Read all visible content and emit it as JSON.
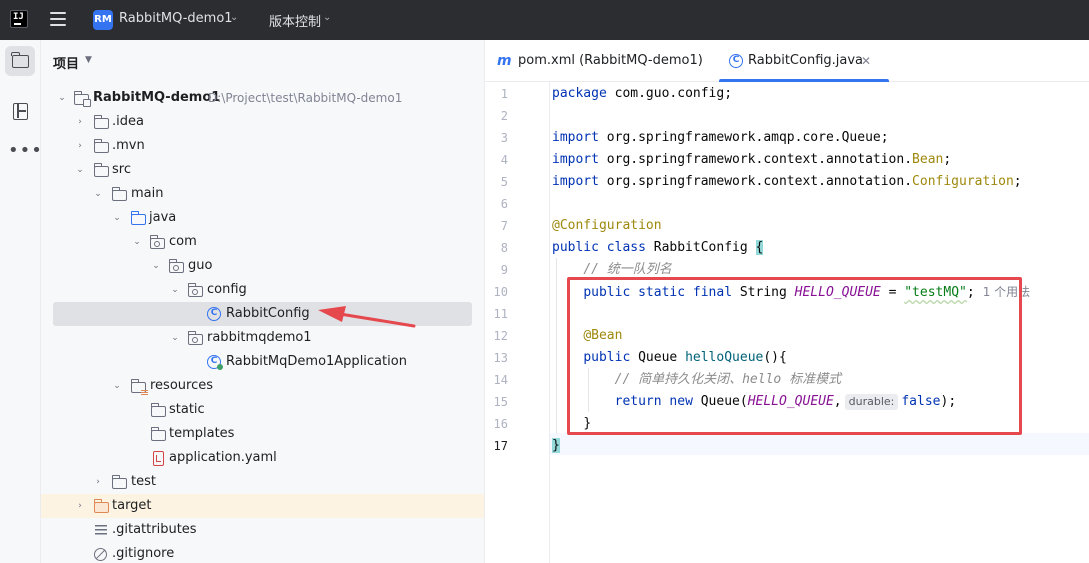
{
  "titlebar": {
    "logo_text": "IJ",
    "project_badge": "RM",
    "project_name": "RabbitMQ-demo1",
    "vcs_label": "版本控制"
  },
  "toolstrip": {
    "items": [
      "project-icon",
      "structure-icon",
      "more-icon"
    ]
  },
  "project_panel": {
    "header": "项目",
    "tree": [
      {
        "label": "RabbitMQ-demo1",
        "path": "D:\\Project\\test\\RabbitMQ-demo1"
      },
      {
        "label": ".idea"
      },
      {
        "label": ".mvn"
      },
      {
        "label": "src"
      },
      {
        "label": "main"
      },
      {
        "label": "java"
      },
      {
        "label": "com"
      },
      {
        "label": "guo"
      },
      {
        "label": "config"
      },
      {
        "label": "RabbitConfig"
      },
      {
        "label": "rabbitmqdemo1"
      },
      {
        "label": "RabbitMqDemo1Application"
      },
      {
        "label": "resources"
      },
      {
        "label": "static"
      },
      {
        "label": "templates"
      },
      {
        "label": "application.yaml"
      },
      {
        "label": "test"
      },
      {
        "label": "target"
      },
      {
        "label": ".gitattributes"
      },
      {
        "label": ".gitignore"
      }
    ]
  },
  "editor": {
    "tabs": [
      {
        "icon": "m",
        "label": "pom.xml (RabbitMQ-demo1)"
      },
      {
        "icon": "C",
        "label": "RabbitConfig.java"
      }
    ],
    "line_numbers": [
      "1",
      "2",
      "3",
      "4",
      "5",
      "6",
      "7",
      "8",
      "9",
      "10",
      "11",
      "12",
      "13",
      "14",
      "15",
      "16",
      "17"
    ],
    "code": {
      "l1_kw": "package",
      "l1_rest": " com.guo.config;",
      "l3_kw": "import",
      "l3_rest": " org.springframework.amqp.core.Queue;",
      "l4_kw": "import",
      "l4_rest": " org.springframework.context.annotation.",
      "l4_ann": "Bean",
      "l4_end": ";",
      "l5_kw": "import",
      "l5_rest": " org.springframework.context.annotation.",
      "l5_ann": "Configuration",
      "l5_end": ";",
      "l7_ann": "@Configuration",
      "l8_kw": "public class",
      "l8_name": " RabbitConfig ",
      "l8_brace": "{",
      "l9_comment": "// 统一队列名",
      "l10_kw": "public static final",
      "l10_type": " String ",
      "l10_const": "HELLO_QUEUE",
      "l10_eq": " = ",
      "l10_str": "\"testMQ\"",
      "l10_semi": ";",
      "l10_usage": "1 个用法",
      "l12_ann": "@Bean",
      "l13_kw": "public",
      "l13_type": " Queue ",
      "l13_method": "helloQueue",
      "l13_rest": "(){",
      "l14_comment": "// 简单持久化关闭、hello 标准模式",
      "l15_kw": "return new",
      "l15_type": " Queue(",
      "l15_const": "HELLO_QUEUE",
      "l15_comma": ",",
      "l15_hint": "durable:",
      "l15_kw2": "false",
      "l15_end": ");",
      "l16": "}",
      "l17": "}"
    }
  },
  "colors": {
    "accent": "#3574f0",
    "annotation_box": "#e5484d",
    "titlebar": "#2b2d30"
  }
}
